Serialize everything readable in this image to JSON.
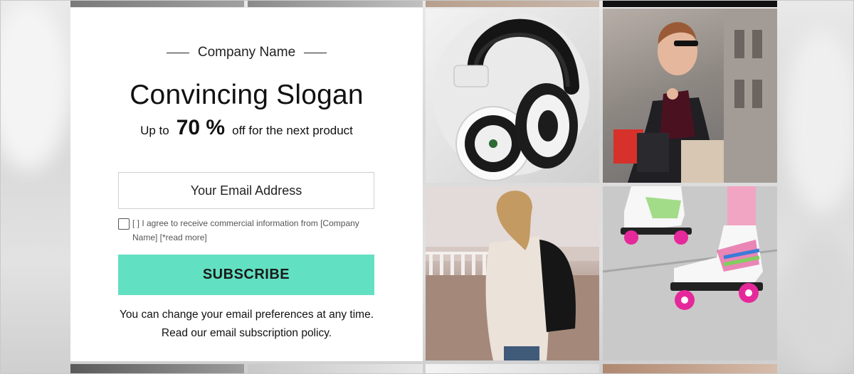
{
  "popup": {
    "company_name": "Company Name",
    "slogan": "Convincing Slogan",
    "offer_prefix": "Up to",
    "offer_value": "70 %",
    "offer_suffix": "off for the next product",
    "email_placeholder": "Your Email Address",
    "consent_text": "[ ] I agree to receive commercial information from [Company Name] [*read more]",
    "subscribe_label": "SUBSCRIBE",
    "footnote_line1": "You can change your email preferences at any time.",
    "footnote_line2": "Read our email subscription policy."
  },
  "gallery": {
    "items": [
      {
        "name": "headphones-photo"
      },
      {
        "name": "woman-with-shopping-bags-photo"
      },
      {
        "name": "woman-with-backpack-photo"
      },
      {
        "name": "roller-skates-photo"
      }
    ]
  },
  "colors": {
    "accent": "#62e0c2",
    "panel_bg": "#ffffff",
    "text": "#111111"
  }
}
